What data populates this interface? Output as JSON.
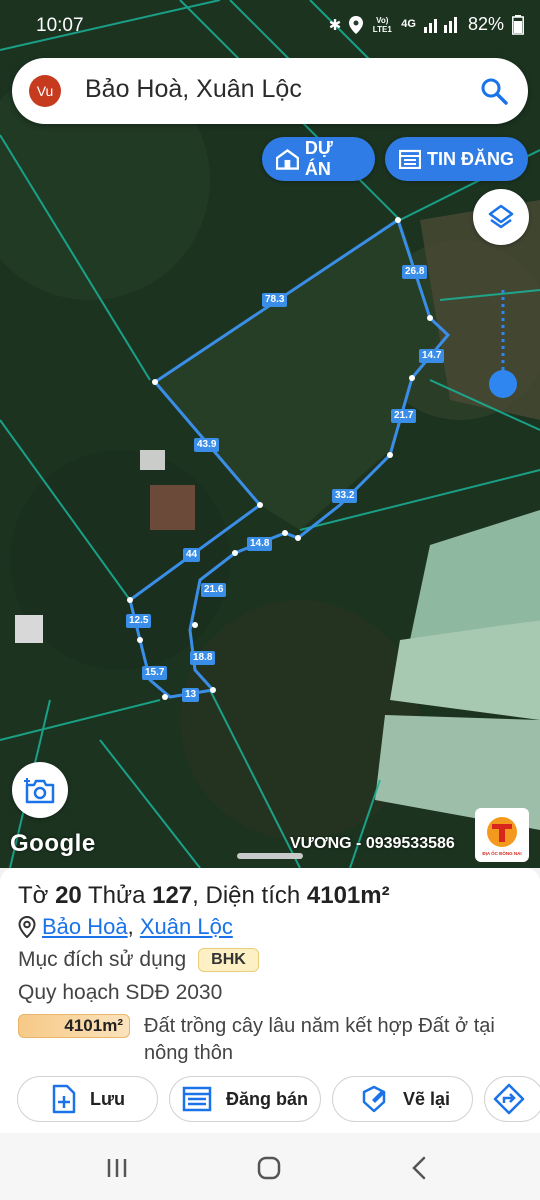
{
  "status_bar": {
    "time": "10:07",
    "network_label": "Vo) LTE1",
    "network_type": "4G",
    "battery": "82%"
  },
  "search": {
    "avatar_initials": "Vu",
    "query": "Bảo Hoà, Xuân Lộc"
  },
  "map_buttons": {
    "project_label": "DỰ ÁN",
    "listing_label": "TIN ĐĂNG"
  },
  "map": {
    "google_label": "Google",
    "watermark": "VƯƠNG - 0939533586",
    "brand_text": "ĐỊA ỐC ĐỒNG NAI",
    "measurements": [
      "78.3",
      "26.8",
      "14.7",
      "21.7",
      "33.2",
      "43.9",
      "14.8",
      "44",
      "21.6",
      "12.5",
      "18.8",
      "15.7",
      "13"
    ]
  },
  "parcel": {
    "to_label": "Tờ",
    "to_value": "20",
    "thua_label": "Thửa",
    "thua_value": "127",
    "area_label": "Diện tích",
    "area_value": "4101m²",
    "ward": "Bảo Hoà",
    "district": "Xuân Lộc",
    "purpose_label": "Mục đích sử dụng",
    "purpose_code": "BHK",
    "plan_label": "Quy hoạch SDĐ 2030",
    "plan_area": "4101m²",
    "plan_desc": "Đất trồng cây lâu năm kết hợp Đất ở tại nông thôn"
  },
  "actions": {
    "save_label": "Lưu",
    "sell_label": "Đăng bán",
    "redraw_label": "Vẽ lại"
  },
  "colors": {
    "accent": "#2f7ce6",
    "parcel_line": "#3b8ee8",
    "link": "#1a73e8",
    "badge_bg": "#fdf0c4"
  }
}
